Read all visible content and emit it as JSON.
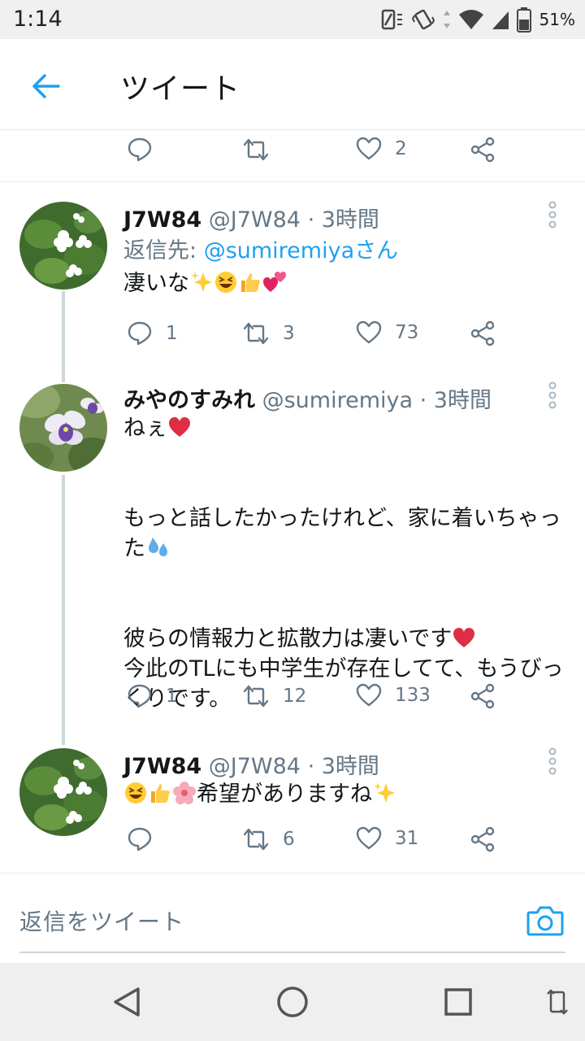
{
  "status_bar": {
    "time": "1:14",
    "battery": "51%"
  },
  "header": {
    "title": "ツイート"
  },
  "prev_tweet": {
    "likes": "2"
  },
  "tweets": [
    {
      "name": "J7W84",
      "handle": "@J7W84",
      "time": "3時間",
      "reply_to_prefix": "返信先: ",
      "reply_to_user": "@sumiremiya",
      "reply_to_suffix": "さん",
      "text": "凄いな",
      "emojis": [
        "sparkles",
        "grinning-squinting",
        "thumbs-up",
        "two-hearts"
      ],
      "replies": "1",
      "retweets": "3",
      "likes": "73"
    },
    {
      "name": "みやのすみれ",
      "handle": "@sumiremiya",
      "time": "3時間",
      "line1": "ねぇ",
      "line2": "もっと話したかったけれど、家に着いちゃった",
      "line3": "彼らの情報力と拡散力は凄いです",
      "line4": "今此のTLにも中学生が存在してて、もうびっくりです。",
      "emojis": [
        "red-heart",
        "sweat-droplets",
        "red-heart"
      ],
      "replies": "1",
      "retweets": "12",
      "likes": "133"
    },
    {
      "name": "J7W84",
      "handle": "@J7W84",
      "time": "3時間",
      "text": "希望がありますね",
      "emojis": [
        "grinning-squinting",
        "thumbs-up",
        "cherry-blossom",
        "sparkles"
      ],
      "replies": "",
      "retweets": "6",
      "likes": "31"
    }
  ],
  "reply_bar": {
    "placeholder": "返信をツイート"
  },
  "colors": {
    "accent": "#1da1f2",
    "secondary_text": "#657786",
    "heart": "#e0245e"
  }
}
